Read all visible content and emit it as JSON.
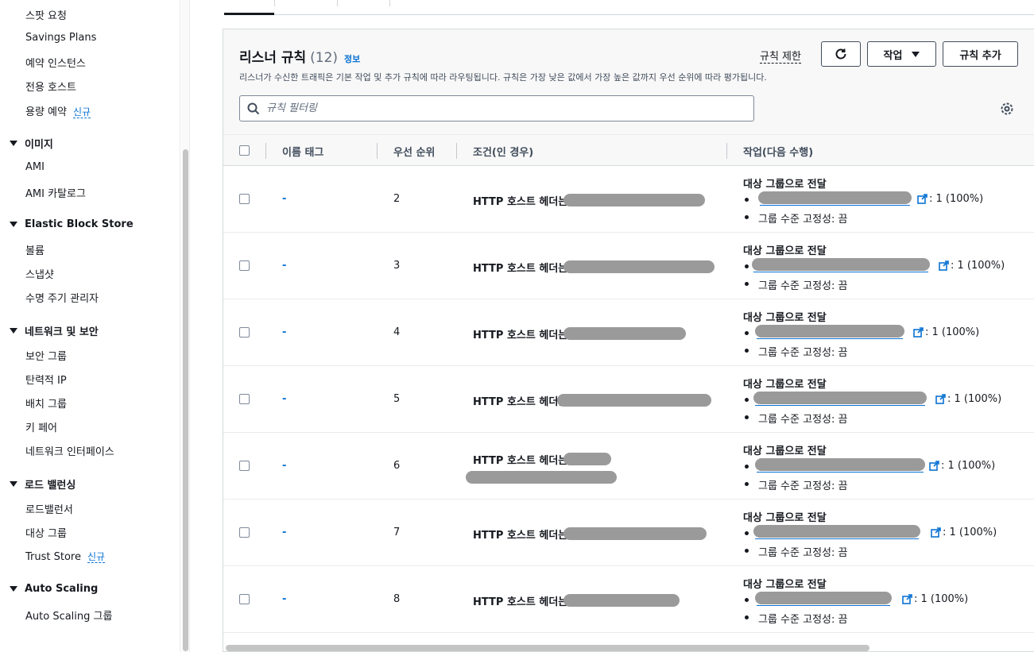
{
  "sidebar": {
    "items_top": [
      {
        "label": "스팟 요청"
      },
      {
        "label": "Savings Plans"
      },
      {
        "label": "예약 인스턴스"
      },
      {
        "label": "전용 호스트"
      },
      {
        "label": "용량 예약",
        "badge": "신규"
      }
    ],
    "sections": [
      {
        "title": "이미지",
        "items": [
          "AMI",
          "AMI 카탈로그"
        ]
      },
      {
        "title": "Elastic Block Store",
        "items": [
          "볼륨",
          "스냅샷",
          "수명 주기 관리자"
        ]
      },
      {
        "title": "네트워크 및 보안",
        "items": [
          "보안 그룹",
          "탄력적 IP",
          "배치 그룹",
          "키 페어",
          "네트워크 인터페이스"
        ]
      },
      {
        "title": "로드 밸런싱",
        "items": [
          "로드밸런서",
          "대상 그룹",
          "Trust Store"
        ]
      },
      {
        "title": "Auto Scaling",
        "items": [
          "Auto Scaling 그룹"
        ]
      }
    ],
    "trust_store_badge": "신규"
  },
  "panel": {
    "title": "리스너 규칙",
    "count": "(12)",
    "info_link": "정보",
    "description": "리스너가 수신한 트래픽은 기본 작업 및 추가 규칙에 따라 라우팅됩니다. 규칙은 가장 낮은 값에서 가장 높은 값까지 우선 순위에 따라 평가됩니다.",
    "rule_limit_label": "규칙 제한",
    "actions_label": "작업",
    "add_rule_label": "규칙 추가",
    "search_placeholder": "규칙 필터링"
  },
  "table": {
    "columns": [
      "이름 태그",
      "우선 순위",
      "조건(인 경우)",
      "작업(다음 수행)"
    ],
    "rows": [
      {
        "name": "-",
        "priority": "2",
        "condition": "HTTP 호스트 헤더는",
        "action_title": "대상 그룹으로 전달",
        "weight": ": 1 (100%)",
        "stickiness": "그룹 수준 고정성: 끔"
      },
      {
        "name": "-",
        "priority": "3",
        "condition": "HTTP 호스트 헤더는",
        "action_title": "대상 그룹으로 전달",
        "weight": ": 1 (100%)",
        "stickiness": "그룹 수준 고정성: 끔"
      },
      {
        "name": "-",
        "priority": "4",
        "condition": "HTTP 호스트 헤더는",
        "action_title": "대상 그룹으로 전달",
        "weight": ": 1 (100%)",
        "stickiness": "그룹 수준 고정성: 끔"
      },
      {
        "name": "-",
        "priority": "5",
        "condition": "HTTP 호스트 헤더는",
        "action_title": "대상 그룹으로 전달",
        "weight": ": 1 (100%)",
        "stickiness": "그룹 수준 고정성: 끔"
      },
      {
        "name": "-",
        "priority": "6",
        "condition": "HTTP 호스트 헤더는",
        "action_title": "대상 그룹으로 전달",
        "weight": ": 1 (100%)",
        "stickiness": "그룹 수준 고정성: 끔"
      },
      {
        "name": "-",
        "priority": "7",
        "condition": "HTTP 호스트 헤더는",
        "action_title": "대상 그룹으로 전달",
        "weight": ": 1 (100%)",
        "stickiness": "그룹 수준 고정성: 끔"
      },
      {
        "name": "-",
        "priority": "8",
        "condition": "HTTP 호스트 헤더는",
        "action_title": "대상 그룹으로 전달",
        "weight": ": 1 (100%)",
        "stickiness": "그룹 수준 고정성: 끔"
      }
    ]
  },
  "colors": {
    "link": "#0972d3",
    "text": "#16191f",
    "redaction": "#9a9a9a"
  },
  "icons": {
    "refresh": "refresh-icon",
    "search": "search-icon",
    "settings": "gear-icon",
    "external": "external-link-icon"
  }
}
